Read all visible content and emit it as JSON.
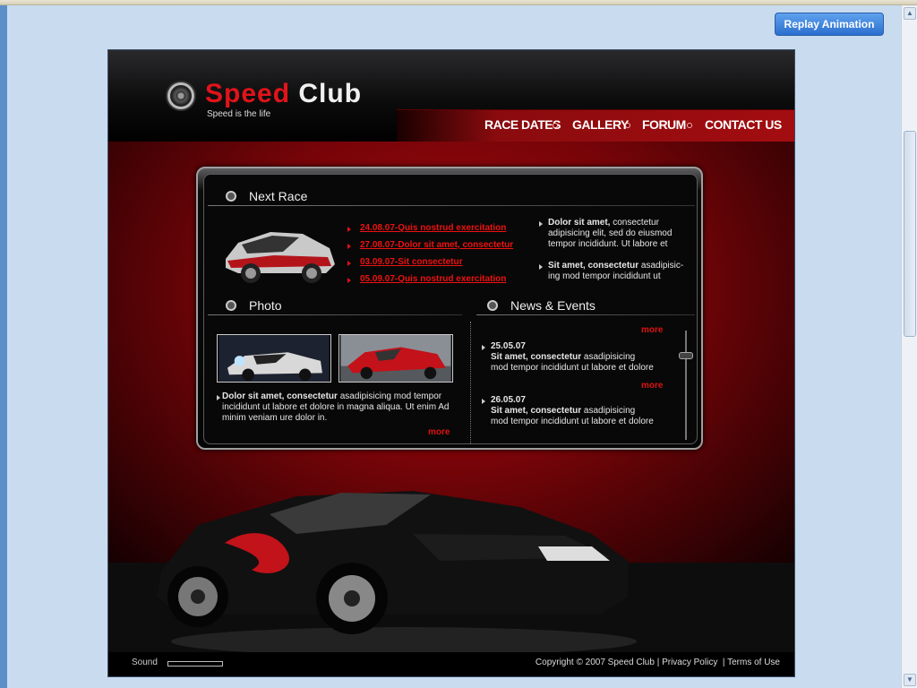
{
  "toolbar": {
    "replay_label": "Replay Animation"
  },
  "site": {
    "logo_part1": "Speed",
    "logo_part2": "Club",
    "tagline": "Speed is the life",
    "nav": [
      "RACE DATES",
      "GALLERY",
      "FORUM",
      "CONTACT US"
    ]
  },
  "next_race": {
    "title": "Next Race",
    "links": [
      "24.08.07-Quis nostrud exercitation",
      "27.08.07-Dolor sit amet, consectetur",
      "03.09.07-Sit consectetur",
      "05.09.07-Quis nostrud exercitation"
    ],
    "notes": [
      {
        "bold": "Dolor sit amet,",
        "rest": " consectetur adipisicing elit, sed do eiusmod tempor incididunt. Ut labore et"
      },
      {
        "bold": "Sit amet, consectetur",
        "rest": " asadipisic-ing  mod tempor incididunt ut"
      }
    ]
  },
  "photo": {
    "title": "Photo",
    "text_bold": "Dolor sit amet, consectetur",
    "text_rest": " asadipisicing  mod tempor incididunt ut labore et dolore in magna aliqua. Ut enim Ad minim veniam ure dolor in.",
    "more": "more"
  },
  "news": {
    "title": "News & Events",
    "more": "more",
    "items": [
      {
        "date": "25.05.07",
        "headline": "Sit amet, consectetur",
        "line1": " asadipisicing",
        "line2": "mod tempor incididunt ut labore et dolore"
      },
      {
        "date": "26.05.07",
        "headline": "Sit amet, consectetur",
        "line1": " asadipisicing",
        "line2": "mod tempor incididunt ut labore et dolore"
      }
    ]
  },
  "footer": {
    "sound": "Sound",
    "copyright": "Copyright © 2007 Speed Club",
    "privacy": "Privacy Policy",
    "terms": "Terms of Use"
  }
}
